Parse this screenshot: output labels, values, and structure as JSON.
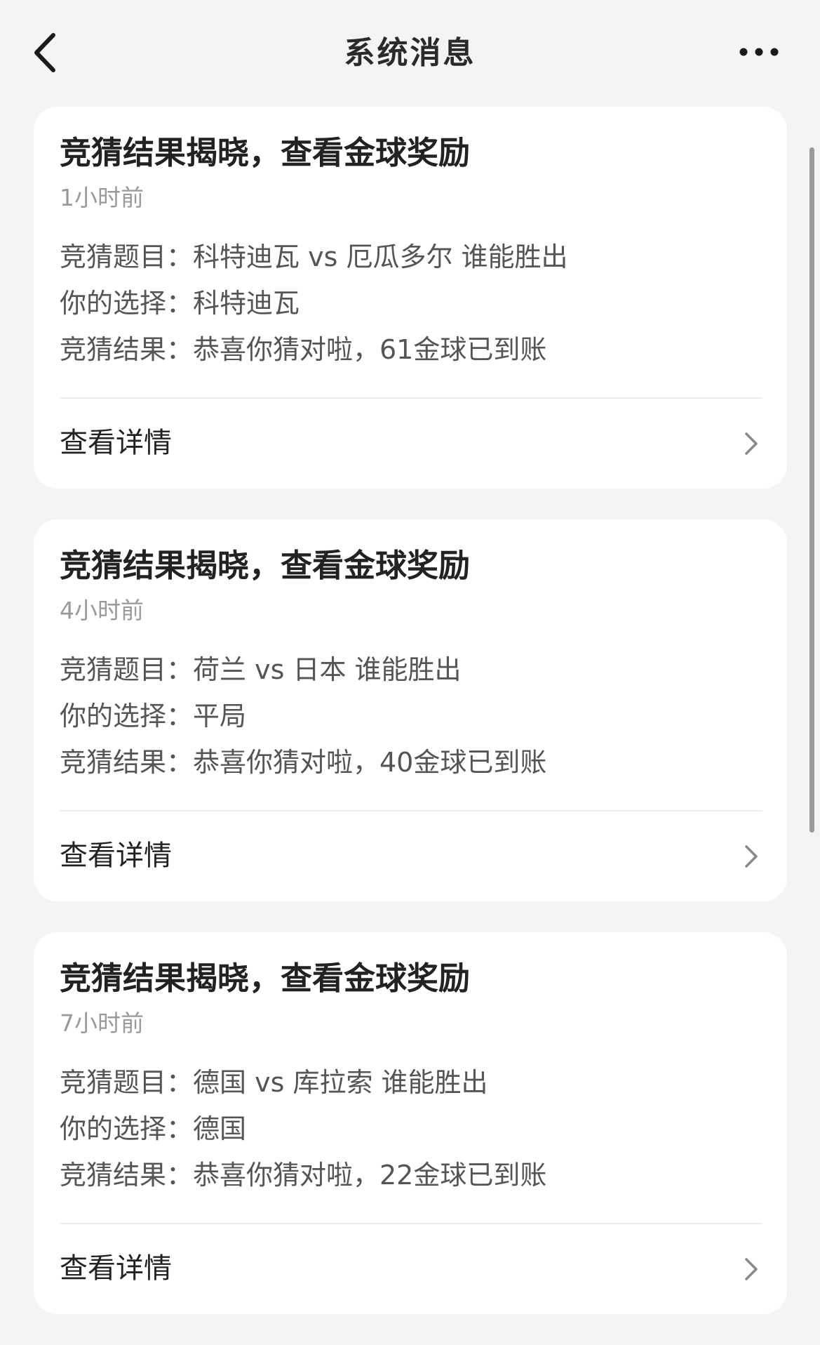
{
  "header": {
    "title": "系统消息"
  },
  "messages": [
    {
      "title": "竞猜结果揭晓，查看金球奖励",
      "time": "1小时前",
      "line1": "竞猜题目：科特迪瓦 vs 厄瓜多尔 谁能胜出",
      "line2": "你的选择：科特迪瓦",
      "line3": "竞猜结果：恭喜你猜对啦，61金球已到账",
      "detail_label": "查看详情"
    },
    {
      "title": "竞猜结果揭晓，查看金球奖励",
      "time": "4小时前",
      "line1": "竞猜题目：荷兰 vs 日本 谁能胜出",
      "line2": "你的选择：平局",
      "line3": "竞猜结果：恭喜你猜对啦，40金球已到账",
      "detail_label": "查看详情"
    },
    {
      "title": "竞猜结果揭晓，查看金球奖励",
      "time": "7小时前",
      "line1": "竞猜题目：德国 vs 库拉索 谁能胜出",
      "line2": "你的选择：德国",
      "line3": "竞猜结果：恭喜你猜对啦，22金球已到账",
      "detail_label": "查看详情"
    }
  ]
}
